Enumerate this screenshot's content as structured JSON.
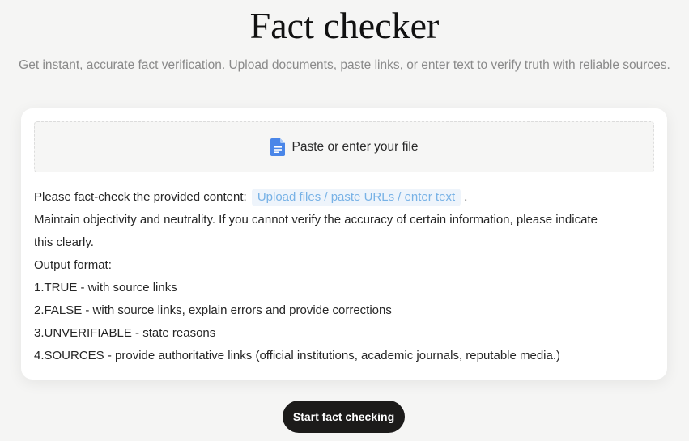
{
  "header": {
    "title": "Fact checker",
    "subtitle": "Get instant, accurate fact verification. Upload documents, paste links, or enter text to verify truth with reliable sources."
  },
  "upload": {
    "label": "Paste or enter your file",
    "icon": "document-icon",
    "icon_color": "#4a86e8"
  },
  "prompt": {
    "intro": "Please fact-check the provided content:",
    "placeholder_chip": "Upload files / paste URLs / enter text",
    "intro_end": ".",
    "line2": "Maintain objectivity and neutrality. If you cannot verify the accuracy of certain information, please indicate",
    "line3": "this clearly.",
    "line4": "Output format:",
    "format_items": [
      "1.TRUE - with source links",
      "2.FALSE - with source links, explain errors and provide corrections",
      "3.UNVERIFIABLE - state reasons",
      "4.SOURCES - provide authoritative links (official institutions, academic journals, reputable media.)"
    ]
  },
  "actions": {
    "start_label": "Start fact checking"
  },
  "colors": {
    "background": "#f5f5f4",
    "chip_text": "#78b2e6",
    "chip_bg": "#eef4fb",
    "button_bg": "#1c1b1a"
  }
}
